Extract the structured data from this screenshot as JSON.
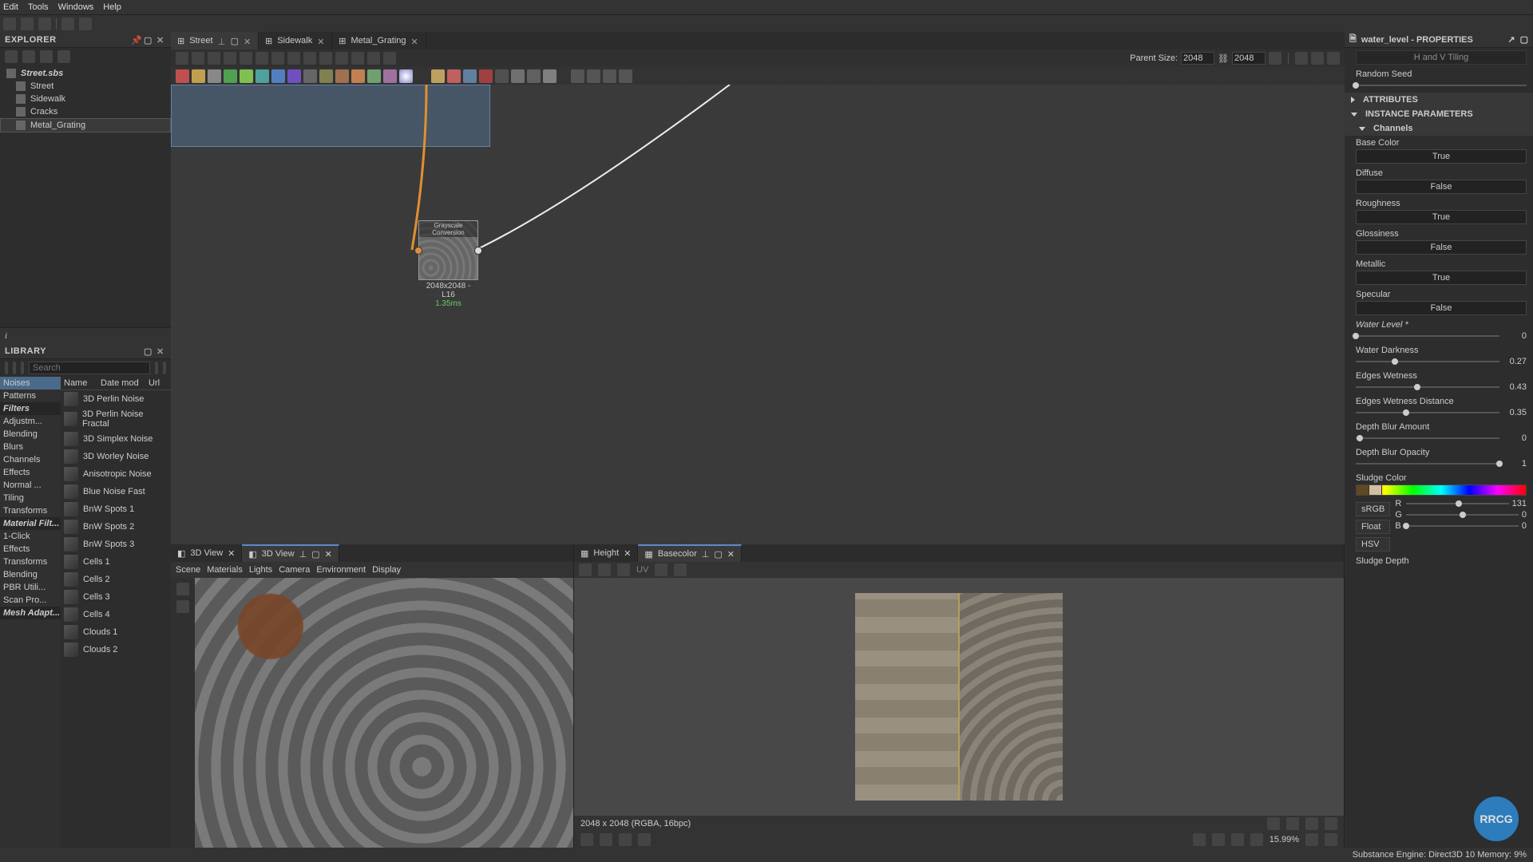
{
  "menu": {
    "edit": "Edit",
    "tools": "Tools",
    "windows": "Windows",
    "help": "Help"
  },
  "explorer": {
    "title": "EXPLORER",
    "root": "Street.sbs",
    "items": [
      "Street",
      "Sidewalk",
      "Cracks",
      "Metal_Grating"
    ],
    "selectedIndex": 3
  },
  "library": {
    "title": "LIBRARY",
    "search_placeholder": "Search",
    "cats_header1": "Filters",
    "cats_header2": "Material Filt...",
    "cats_header3": "Mesh Adapt...",
    "catsA": [
      "Noises",
      "Patterns"
    ],
    "catsB": [
      "Adjustm...",
      "Blending",
      "Blurs",
      "Channels",
      "Effects",
      "Normal ...",
      "Tiling",
      "Transforms"
    ],
    "catsC": [
      "1-Click",
      "Effects",
      "Transforms",
      "Blending",
      "PBR Utili...",
      "Scan Pro..."
    ],
    "cols": {
      "name": "Name",
      "date": "Date mod",
      "url": "Url"
    },
    "items": [
      "3D Perlin Noise",
      "3D Perlin Noise Fractal",
      "3D Simplex Noise",
      "3D Worley Noise",
      "Anisotropic Noise",
      "Blue Noise Fast",
      "BnW Spots 1",
      "BnW Spots 2",
      "BnW Spots 3",
      "Cells 1",
      "Cells 2",
      "Cells 3",
      "Cells 4",
      "Clouds 1",
      "Clouds 2"
    ]
  },
  "graph": {
    "tabs": [
      "Street",
      "Sidewalk",
      "Metal_Grating"
    ],
    "activeTab": 0,
    "parent_size_label": "Parent Size:",
    "parent_w": "2048",
    "parent_h": "2048",
    "node_title": "Grayscale Conversion",
    "node_res": "2048x2048 - L16",
    "node_time": "1.35ms"
  },
  "view3d": {
    "tab1": "3D View",
    "tab2": "3D View",
    "menus": [
      "Scene",
      "Materials",
      "Lights",
      "Camera",
      "Environment",
      "Display"
    ]
  },
  "view2d": {
    "tab1": "Height",
    "tab2": "Basecolor",
    "uv": "UV",
    "info": "2048 x 2048 (RGBA, 16bpc)",
    "zoom": "15.99%"
  },
  "props": {
    "title": "water_level - PROPERTIES",
    "hv": "H and V Tiling",
    "random_seed": "Random Seed",
    "attributes": "ATTRIBUTES",
    "instance": "INSTANCE PARAMETERS",
    "channels": "Channels",
    "ch": {
      "basecolor": "Base Color",
      "basecolor_v": "True",
      "diffuse": "Diffuse",
      "diffuse_v": "False",
      "roughness": "Roughness",
      "roughness_v": "True",
      "glossiness": "Glossiness",
      "glossiness_v": "False",
      "metallic": "Metallic",
      "metallic_v": "True",
      "specular": "Specular",
      "specular_v": "False"
    },
    "water_level": "Water Level *",
    "water_level_v": "0",
    "water_dark": "Water Darkness",
    "water_dark_v": "0.27",
    "edges_wet": "Edges Wetness",
    "edges_wet_v": "0.43",
    "edges_wet_dist": "Edges Wetness Distance",
    "edges_wet_dist_v": "0.35",
    "depth_blur_amt": "Depth Blur Amount",
    "depth_blur_amt_v": "0",
    "depth_blur_op": "Depth Blur Opacity",
    "depth_blur_op_v": "1",
    "sludge_color": "Sludge Color",
    "srgb": "sRGB",
    "float": "Float",
    "hsv": "HSV",
    "r": "R",
    "g": "G",
    "b": "B",
    "r_v": "131",
    "g_v": "0",
    "b_v": "0",
    "sludge_depth": "Sludge Depth"
  },
  "statusbar": {
    "engine": "Substance Engine: Direct3D 10  Memory: 9%"
  }
}
